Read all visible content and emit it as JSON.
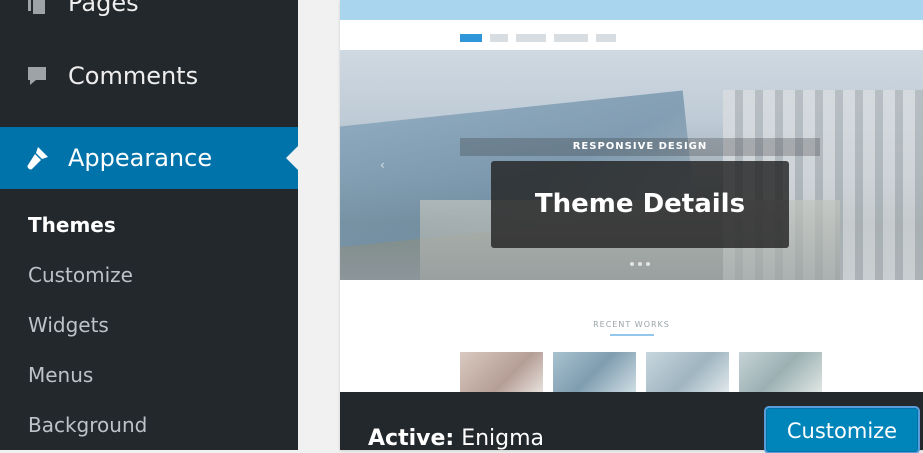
{
  "sidebar": {
    "items": [
      {
        "label": "Pages",
        "icon": "pages-icon"
      },
      {
        "label": "Comments",
        "icon": "comments-icon"
      },
      {
        "label": "Appearance",
        "icon": "brush-icon"
      }
    ],
    "submenu": [
      {
        "label": "Themes",
        "current": true
      },
      {
        "label": "Customize"
      },
      {
        "label": "Widgets"
      },
      {
        "label": "Menus"
      },
      {
        "label": "Background"
      }
    ]
  },
  "theme": {
    "hero_strip": "RESPONSIVE DESIGN",
    "details_label": "Theme Details",
    "recent_works": "RECENT WORKS",
    "active_prefix": "Active:",
    "active_name": "Enigma",
    "customize_label": "Customize"
  },
  "colors": {
    "sidebar_bg": "#23282d",
    "active_menu": "#0073aa",
    "customize_btn": "#0085ba"
  }
}
